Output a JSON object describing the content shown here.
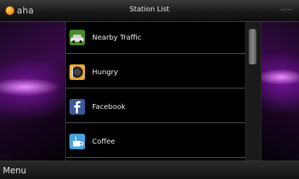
{
  "header": {
    "logo_text": "aha",
    "title": "Station List",
    "clock": "--:--"
  },
  "stations": [
    {
      "label": "Nearby Traffic",
      "icon": "traffic-car-icon",
      "icon_bg": "#4a8a2a"
    },
    {
      "label": "Hungry",
      "icon": "hungry-plate-icon",
      "icon_bg": "#e7a93a"
    },
    {
      "label": "Facebook",
      "icon": "facebook-icon",
      "icon_bg": "#3b5998"
    },
    {
      "label": "Coffee",
      "icon": "coffee-cup-icon",
      "icon_bg": "#4aa3dd"
    }
  ],
  "footer": {
    "menu_label": "Menu"
  },
  "colors": {
    "accent_purple": "#9b2bd0",
    "logo_orange": "#f08a00"
  }
}
